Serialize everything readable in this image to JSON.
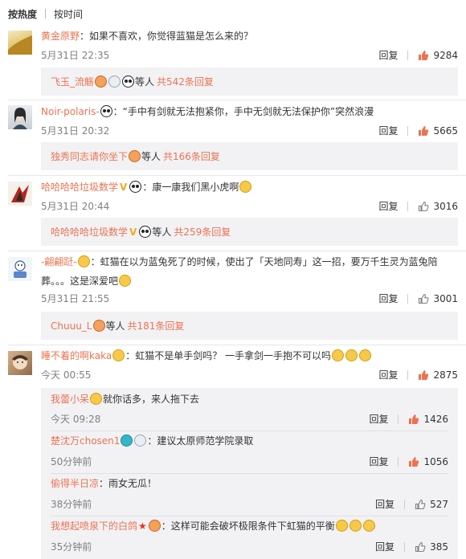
{
  "sort": {
    "hot": "按热度",
    "time": "按时间"
  },
  "actions": {
    "reply": "回复"
  },
  "comments": [
    {
      "user": "黄金原野",
      "text": "：如果不喜欢，你觉得蓝猫是怎么来的？",
      "time": "5月31日 22:35",
      "likes": "9284",
      "replies": {
        "user": "飞玉_流觞",
        "suffix": "等人",
        "more": "共542条回复"
      }
    },
    {
      "user": "Noir-polaris-",
      "text": "：“手中有剑就无法抱紧你，手中无剑就无法保护你”突然浪漫",
      "time": "5月31日 20:32",
      "likes": "5665",
      "replies": {
        "user": "独秀同志请你坐下",
        "suffix": "等人",
        "more": "共166条回复"
      }
    },
    {
      "user": "哈哈哈哈垃圾数学",
      "text": "：康一康我们黑小虎啊",
      "time": "5月31日 20:44",
      "likes": "3016",
      "replies": {
        "user": "哈哈哈哈垃圾数学",
        "suffix": "等人",
        "more": "共259条回复"
      }
    },
    {
      "user": "-翩翩跹-",
      "text": "：虹猫在以为蓝兔死了的时候，使出了「天地同寿」这一招，要万千生灵为蓝兔陪",
      "text2": "葬。。。这是深爱吧",
      "time": "5月31日 21:55",
      "likes": "3001",
      "replies": {
        "user": "Chuuu_L",
        "suffix": "等人",
        "more": "共181条回复"
      }
    },
    {
      "user": "睡不着的啊kaka",
      "text": "：虹猫不是单手剑吗？ 一手拿剑一手抱不可以吗",
      "time": "今天 00:55",
      "likes": "2875"
    }
  ],
  "subs": [
    {
      "user": "我蕾小呆",
      "text": "就你话多，来人拖下去",
      "time": "今天 09:28",
      "likes": "1426"
    },
    {
      "user": "楚沈万chosen1",
      "text": "：建议太原师范学院录取",
      "time": "50分钟前",
      "likes": "1056"
    },
    {
      "user": "偷得半日凉",
      "text": "：雨女无瓜！",
      "time": "38分钟前",
      "likes": "527"
    },
    {
      "user": "我想起喷泉下的白鸽",
      "text": "：这样可能会破坏极限条件下虹猫的平衡",
      "time": "35分钟前",
      "likes": "385"
    }
  ]
}
